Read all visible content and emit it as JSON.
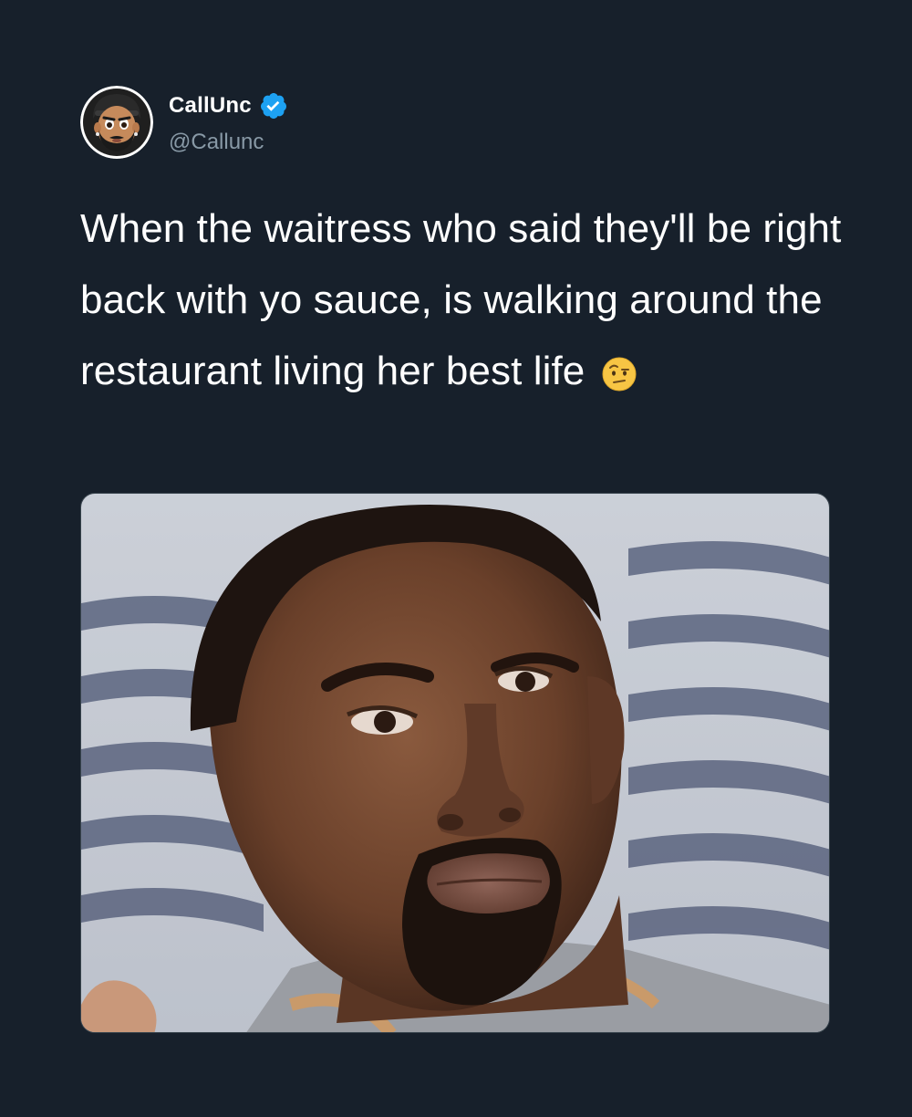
{
  "user": {
    "display_name": "CallUnc",
    "handle": "@Callunc",
    "verified": true,
    "avatar_icon": "cartoon-bearded-man-cap-avatar"
  },
  "tweet": {
    "text": "When the waitress who said they'll be right back with yo sauce, is walking around the restaurant living her best life",
    "emoji": "face-with-raised-eyebrow-icon"
  },
  "media": {
    "type": "photo",
    "description_icon": "man-pouting-face-photo"
  },
  "colors": {
    "background": "#17202b",
    "text": "#ffffff",
    "secondary_text": "#8899a6",
    "verified_blue": "#1da1f2"
  }
}
